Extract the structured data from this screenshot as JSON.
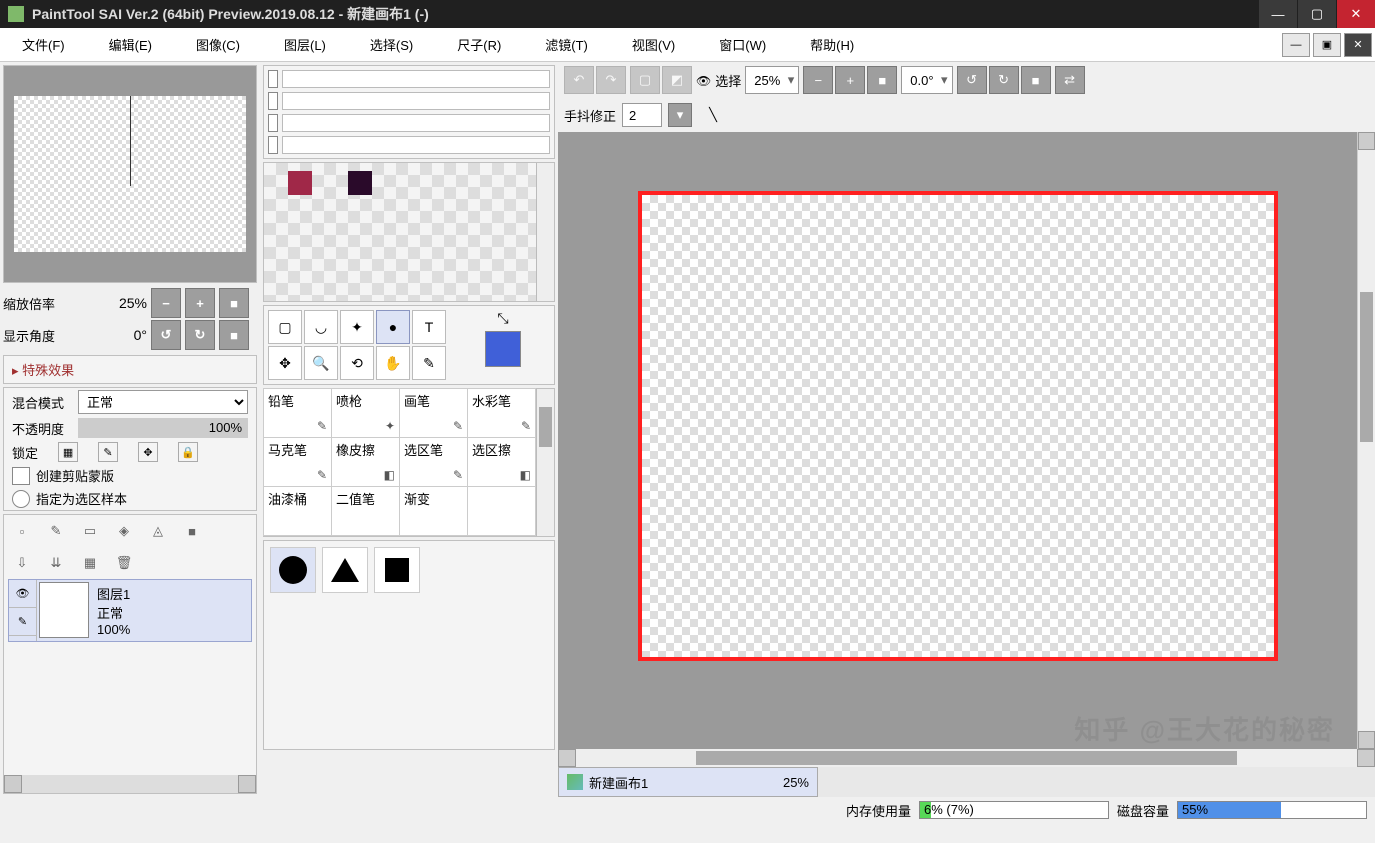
{
  "titlebar": {
    "title": "PaintTool SAI Ver.2 (64bit) Preview.2019.08.12 - 新建画布1 (-)"
  },
  "menu": [
    "文件(F)",
    "编辑(E)",
    "图像(C)",
    "图层(L)",
    "选择(S)",
    "尺子(R)",
    "滤镜(T)",
    "视图(V)",
    "窗口(W)",
    "帮助(H)"
  ],
  "nav": {
    "zoom_label": "缩放倍率",
    "zoom_value": "25%",
    "angle_label": "显示角度",
    "angle_value": "0°"
  },
  "effects": {
    "header": "特殊效果"
  },
  "blend": {
    "mode_label": "混合模式",
    "mode_value": "正常",
    "opacity_label": "不透明度",
    "opacity_value": "100%",
    "lock_label": "锁定",
    "clip_label": "创建剪贴蒙版",
    "sel_source_label": "指定为选区样本"
  },
  "layer": {
    "name": "图层1",
    "mode": "正常",
    "opacity": "100%"
  },
  "brushes": [
    "铅笔",
    "喷枪",
    "画笔",
    "水彩笔",
    "马克笔",
    "橡皮擦",
    "选区笔",
    "选区擦",
    "油漆桶",
    "二值笔",
    "渐变",
    ""
  ],
  "canvas_toolbar": {
    "select_label": "选择",
    "zoom_value": "25%",
    "angle_value": "0.0°"
  },
  "stabilizer": {
    "label": "手抖修正",
    "value": "2"
  },
  "doc_tab": {
    "name": "新建画布1",
    "zoom": "25%"
  },
  "status": {
    "mem_label": "内存使用量",
    "mem_text": "6% (7%)",
    "mem_fill": "6%",
    "disk_label": "磁盘容量",
    "disk_text": "55%",
    "disk_fill": "55%"
  },
  "watermark": "知乎 @王大花的秘密"
}
